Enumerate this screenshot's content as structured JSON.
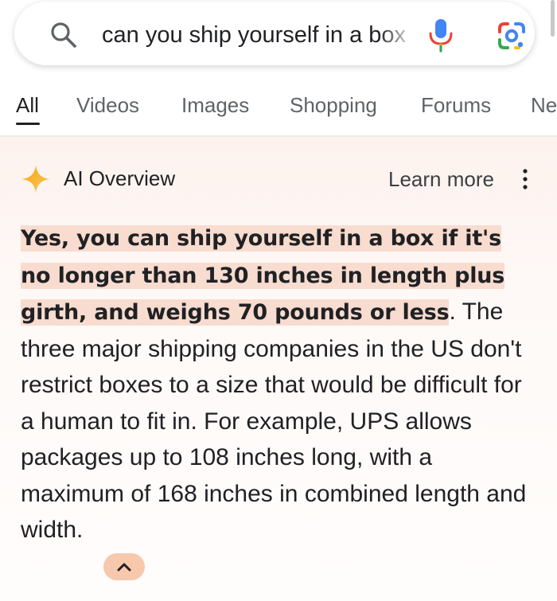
{
  "search": {
    "query": "can you ship yourself in a box"
  },
  "tabs": [
    {
      "label": "All",
      "active": true
    },
    {
      "label": "Videos",
      "active": false
    },
    {
      "label": "Images",
      "active": false
    },
    {
      "label": "Shopping",
      "active": false
    },
    {
      "label": "Forums",
      "active": false
    },
    {
      "label": "Ne",
      "active": false
    }
  ],
  "ai_overview": {
    "title": "AI Overview",
    "learn_more": "Learn more",
    "highlighted_answer": "Yes, you can ship yourself in a box if it's no longer than 130 inches in length plus girth, and weighs 70 pounds or less",
    "highlight_end": ".",
    "body_text": "The three major shipping companies in the US don't restrict boxes to a size that would be difficult for a human to fit in. For example, UPS allows packages up to 108 inches long, with a maximum of 168 inches in combined length and width.",
    "highlight_color": "#f8dccf",
    "collapse_button_color": "#f8c8ad"
  },
  "icons": {
    "search": "search-icon",
    "mic": "microphone-icon",
    "lens": "google-lens-icon",
    "sparkle": "ai-sparkle-icon",
    "more": "more-vertical-icon",
    "collapse": "chevron-up-icon"
  }
}
